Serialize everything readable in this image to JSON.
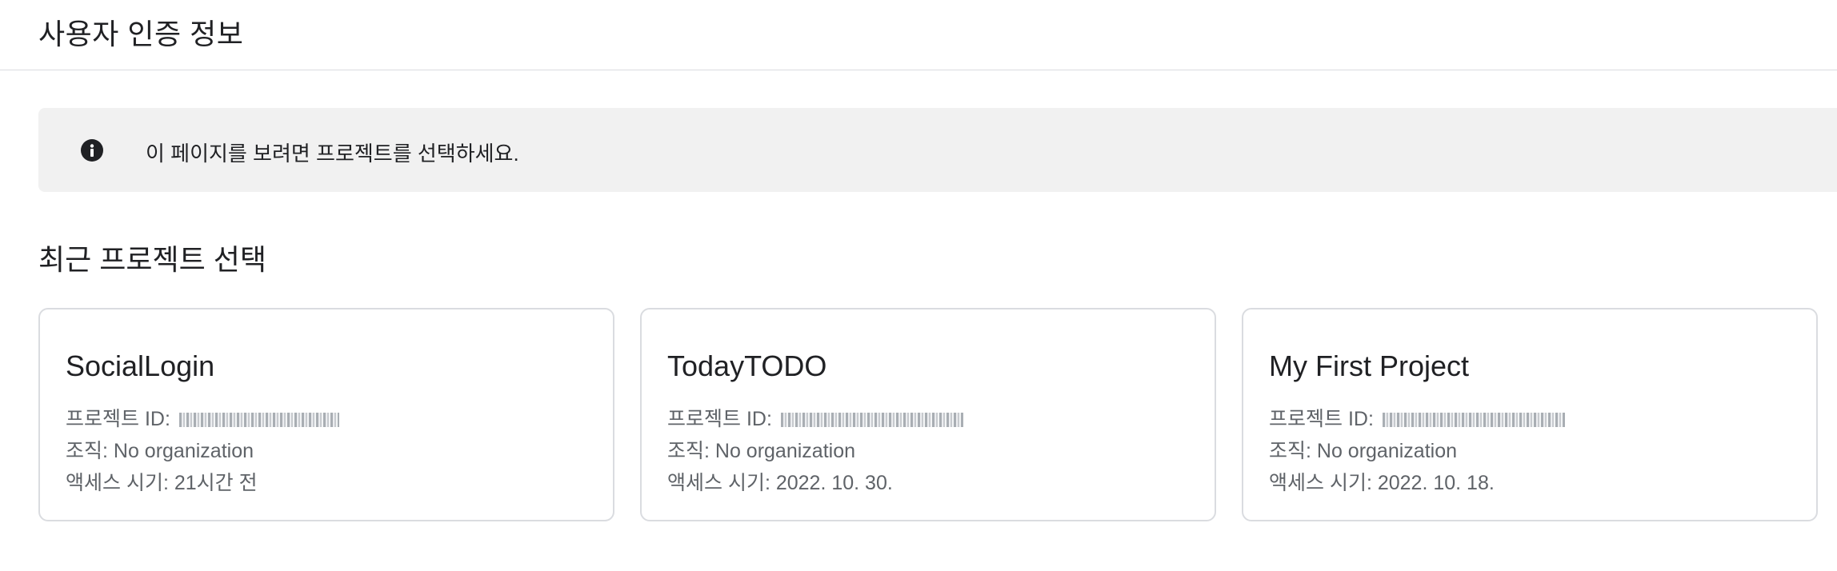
{
  "header": {
    "title": "사용자 인증 정보"
  },
  "banner": {
    "icon": "info-icon",
    "message": "이 페이지를 보려면 프로젝트를 선택하세요."
  },
  "recent": {
    "title": "최근 프로젝트 선택",
    "projects": [
      {
        "name": "SocialLogin",
        "id_label": "프로젝트 ID:",
        "org_line": "조직: No organization",
        "access_line": "액세스 시기: 21시간 전"
      },
      {
        "name": "TodayTODO",
        "id_label": "프로젝트 ID:",
        "org_line": "조직: No organization",
        "access_line": "액세스 시기: 2022. 10. 30."
      },
      {
        "name": "My First Project",
        "id_label": "프로젝트 ID:",
        "org_line": "조직: No organization",
        "access_line": "액세스 시기: 2022. 10. 18."
      }
    ]
  }
}
